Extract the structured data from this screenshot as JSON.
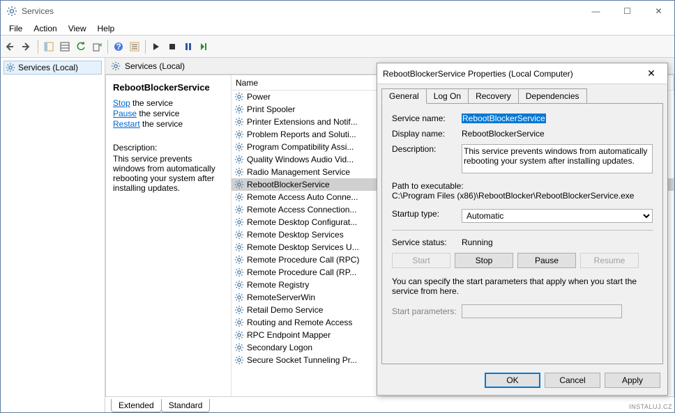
{
  "window": {
    "title": "Services",
    "minimize": "—",
    "maximize": "☐",
    "close": "✕"
  },
  "menu": {
    "file": "File",
    "action": "Action",
    "view": "View",
    "help": "Help"
  },
  "tree": {
    "root": "Services (Local)"
  },
  "header": {
    "title": "Services (Local)"
  },
  "detail": {
    "name": "RebootBlockerService",
    "stop": "Stop",
    "stop_suffix": " the service",
    "pause": "Pause",
    "pause_suffix": " the service",
    "restart": "Restart",
    "restart_suffix": " the service",
    "desc_label": "Description:",
    "desc_text": "This service prevents windows from automatically rebooting your system after installing updates."
  },
  "columns": {
    "name": "Name",
    "sort_indicator": "˄"
  },
  "services": [
    "Power",
    "Print Spooler",
    "Printer Extensions and Notif...",
    "Problem Reports and Soluti...",
    "Program Compatibility Assi...",
    "Quality Windows Audio Vid...",
    "Radio Management Service",
    "RebootBlockerService",
    "Remote Access Auto Conne...",
    "Remote Access Connection...",
    "Remote Desktop Configurat...",
    "Remote Desktop Services",
    "Remote Desktop Services U...",
    "Remote Procedure Call (RPC)",
    "Remote Procedure Call (RP...",
    "Remote Registry",
    "RemoteServerWin",
    "Retail Demo Service",
    "Routing and Remote Access",
    "RPC Endpoint Mapper",
    "Secondary Logon",
    "Secure Socket Tunneling Pr..."
  ],
  "selected_index": 7,
  "bottom_tabs": {
    "extended": "Extended",
    "standard": "Standard"
  },
  "dialog": {
    "title": "RebootBlockerService Properties (Local Computer)",
    "close": "✕",
    "tabs": {
      "general": "General",
      "logon": "Log On",
      "recovery": "Recovery",
      "deps": "Dependencies"
    },
    "labels": {
      "service_name": "Service name:",
      "display_name": "Display name:",
      "description": "Description:",
      "path": "Path to executable:",
      "startup": "Startup type:",
      "status": "Service status:",
      "hint": "You can specify the start parameters that apply when you start the service from here.",
      "start_params": "Start parameters:"
    },
    "values": {
      "service_name": "RebootBlockerService",
      "display_name": "RebootBlockerService",
      "description": "This service prevents windows from automatically rebooting your system after installing updates.",
      "path": "C:\\Program Files (x86)\\RebootBlocker\\RebootBlockerService.exe",
      "startup": "Automatic",
      "status": "Running",
      "start_params": ""
    },
    "buttons": {
      "start": "Start",
      "stop": "Stop",
      "pause": "Pause",
      "resume": "Resume",
      "ok": "OK",
      "cancel": "Cancel",
      "apply": "Apply"
    }
  },
  "watermark": "INSTALUJ.CZ"
}
